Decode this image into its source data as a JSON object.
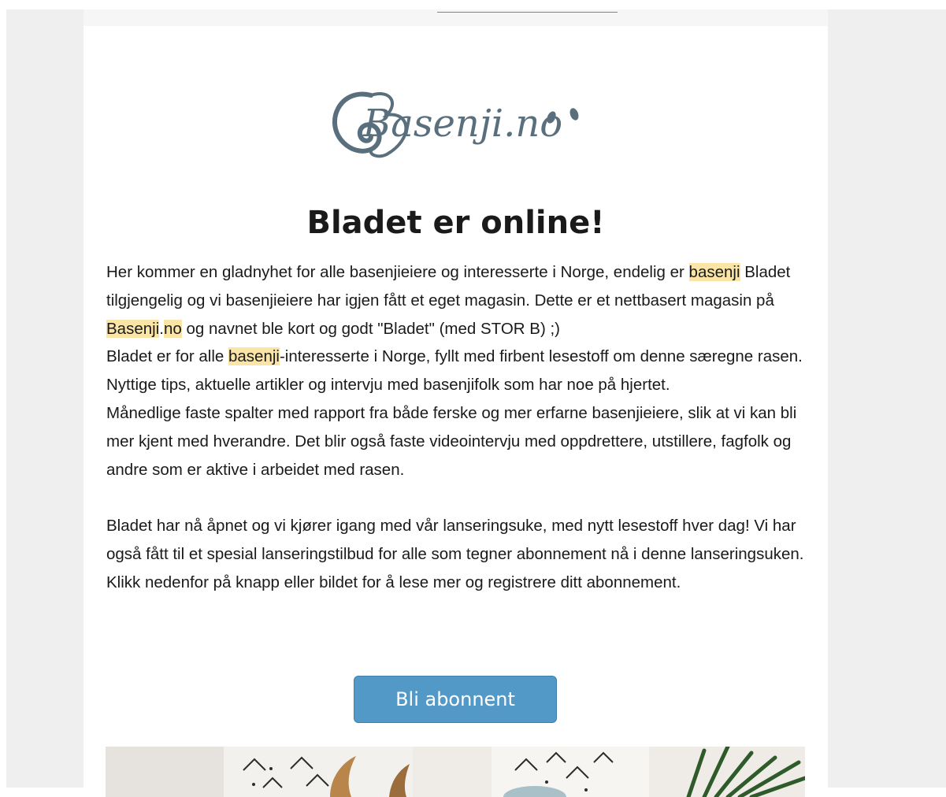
{
  "logo": {
    "text": "Basenji.no"
  },
  "headline": "Bladet er online!",
  "body": {
    "p1_a": "Her kommer en gladnyhet for alle basenjieiere og interesserte i Norge, endelig er ",
    "p1_hl1": "basenji",
    "p1_b": " Bladet tilgjengelig og vi basenjieiere har igjen fått et eget magasin. Dette er et nettbasert magasin på ",
    "p1_hl2": "Basenji",
    "p1_dot": ".",
    "p1_hl3": "no",
    "p1_c": " og navnet ble kort og godt \"Bladet\" (med STOR B) ;)",
    "p2_a": "Bladet er for alle ",
    "p2_hl": "basenji",
    "p2_b": "-interesserte i Norge, fyllt med firbent lesestoff om denne særegne rasen. Nyttige tips, aktuelle artikler og intervju med basenjifolk som har noe på hjertet.",
    "p3": "Månedlige faste spalter med rapport fra både ferske og mer erfarne basenjieiere, slik at vi kan bli mer kjent med hverandre. Det blir også faste videointervju med oppdrettere, utstillere, fagfolk og andre som er aktive i arbeidet med rasen.",
    "p4": "Bladet har nå åpnet og vi kjører igang med vår lanseringsuke, med nytt lesestoff hver dag! Vi har også fått til et spesial lanseringstilbud for alle som tegner abonnement nå i denne lanseringsuken. Klikk nedenfor på knapp eller bildet for å lese mer og registrere ditt abonnement."
  },
  "cta": {
    "label": "Bli abonnent"
  },
  "colors": {
    "highlight": "#fbe5a6",
    "button": "#5399c8",
    "logo": "#5a6f7e"
  }
}
